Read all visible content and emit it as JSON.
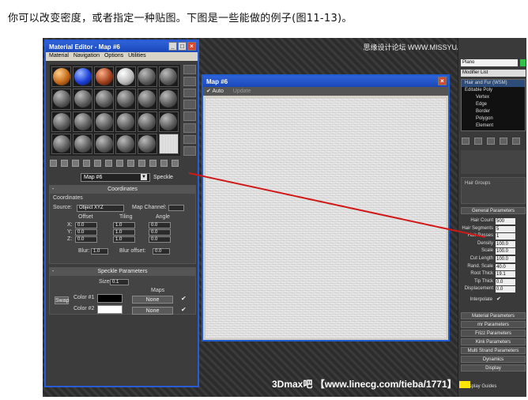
{
  "caption": "你可以改变密度，或者指定一种贴图。下图是一些能做的例子(图11-13)。",
  "watermark": "思缘设计论坛 WWW.MISSYUAN.COM",
  "banner": "3Dmax吧 【www.linecg.com/tieba/1771】",
  "material_editor": {
    "title": "Material Editor - Map #6",
    "menu": [
      "Material",
      "Navigation",
      "Options",
      "Utilities"
    ],
    "map_name": "Map #6",
    "map_type": "Speckle",
    "coordinates": {
      "header": "Coordinates",
      "subheader": "Coordinates",
      "source_label": "Source:",
      "source_value": "Object XYZ",
      "map_channel_label": "Map Channel:",
      "offset_label": "Offset",
      "tiling_label": "Tiling",
      "angle_label": "Angle",
      "axes": [
        "X:",
        "Y:",
        "Z:"
      ],
      "offset": [
        "0.0",
        "0.0",
        "0.0"
      ],
      "tiling": [
        "1.0",
        "1.0",
        "1.0"
      ],
      "angle": [
        "0.0",
        "0.0",
        "0.0"
      ],
      "blur_label": "Blur:",
      "blur_value": "1.0",
      "blur_offset_label": "Blur offset:",
      "blur_offset_value": "0.0"
    },
    "speckle": {
      "header": "Speckle Parameters",
      "size_label": "Size:",
      "size_value": "0.1",
      "maps_label": "Maps",
      "swap_label": "Swap",
      "color1_label": "Color #1",
      "color2_label": "Color #2",
      "color1": "#000000",
      "color2": "#ffffff",
      "map1": "None",
      "map2": "None"
    }
  },
  "map_window": {
    "title": "Map #6",
    "auto_label": "Auto",
    "update_label": "Update"
  },
  "right_panel": {
    "name_field": "Plano",
    "modifier_list": "Modifier List",
    "stack": [
      {
        "label": "Hair and Fur (WSM)",
        "sub": false
      },
      {
        "label": "Editable Poly",
        "sub": false
      },
      {
        "label": "Vertex",
        "sub": true
      },
      {
        "label": "Edge",
        "sub": true
      },
      {
        "label": "Border",
        "sub": true
      },
      {
        "label": "Polygon",
        "sub": true
      },
      {
        "label": "Element",
        "sub": true
      }
    ],
    "hair_groups": "Hair Groups",
    "general_params_header": "General Parameters",
    "params": [
      {
        "label": "Hair Count",
        "value": "500"
      },
      {
        "label": "Hair Segments",
        "value": "5"
      },
      {
        "label": "Hair Passes",
        "value": "1"
      },
      {
        "label": "Density",
        "value": "100.0"
      },
      {
        "label": "Scale",
        "value": "100.0"
      },
      {
        "label": "Cut Length",
        "value": "100.0"
      },
      {
        "label": "Rand. Scale",
        "value": "40.0"
      },
      {
        "label": "Root Thick",
        "value": "19.1"
      },
      {
        "label": "Tip Thick",
        "value": "0.0"
      },
      {
        "label": "Displacement",
        "value": "0.0"
      }
    ],
    "interpolate_label": "Interpolate",
    "rollouts": [
      "Material Parameters",
      "mr Parameters",
      "Frizz Parameters",
      "Kink Parameters",
      "Multi Strand Parameters",
      "Dynamics",
      "Display"
    ],
    "display_guides": "Display Guides"
  },
  "annotation_color": "#d01818",
  "accent_blue": "#2a5bd6"
}
